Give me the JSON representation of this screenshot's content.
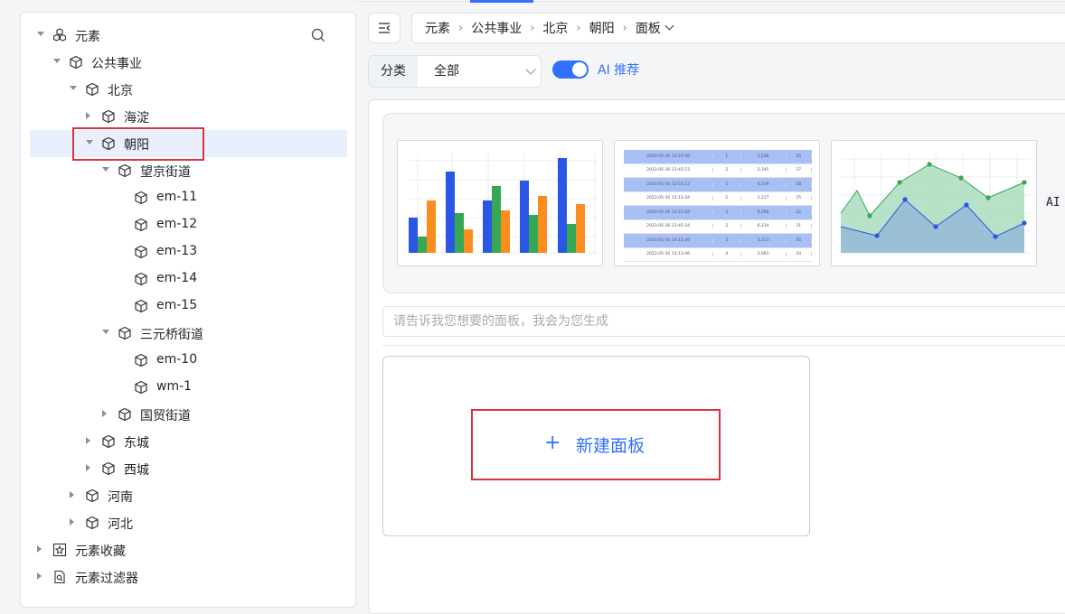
{
  "tree": {
    "items": [
      {
        "label": "元素",
        "icon": "elements-icon",
        "caret": "down"
      },
      {
        "label": "公共事业",
        "icon": "cube-icon",
        "caret": "down"
      },
      {
        "label": "北京",
        "icon": "cube-icon",
        "caret": "down"
      },
      {
        "label": "海淀",
        "icon": "cube-icon",
        "caret": "right"
      },
      {
        "label": "朝阳",
        "icon": "cube-icon",
        "caret": "down",
        "selected": true
      },
      {
        "label": "望京街道",
        "icon": "cube-icon",
        "caret": "down"
      },
      {
        "label": "em-11",
        "icon": "cube-icon",
        "caret": "none"
      },
      {
        "label": "em-12",
        "icon": "cube-icon",
        "caret": "none"
      },
      {
        "label": "em-13",
        "icon": "cube-icon",
        "caret": "none"
      },
      {
        "label": "em-14",
        "icon": "cube-icon",
        "caret": "none"
      },
      {
        "label": "em-15",
        "icon": "cube-icon",
        "caret": "none"
      },
      {
        "label": "三元桥街道",
        "icon": "cube-icon",
        "caret": "down"
      },
      {
        "label": "em-10",
        "icon": "cube-icon",
        "caret": "none"
      },
      {
        "label": "wm-1",
        "icon": "cube-icon",
        "caret": "none"
      },
      {
        "label": "国贸街道",
        "icon": "cube-icon",
        "caret": "right"
      },
      {
        "label": "东城",
        "icon": "cube-icon",
        "caret": "right"
      },
      {
        "label": "西城",
        "icon": "cube-icon",
        "caret": "right"
      },
      {
        "label": "河南",
        "icon": "cube-icon",
        "caret": "right"
      },
      {
        "label": "河北",
        "icon": "cube-icon",
        "caret": "right"
      },
      {
        "label": "元素收藏",
        "icon": "star-box-icon",
        "caret": "right"
      },
      {
        "label": "元素过滤器",
        "icon": "filter-doc-icon",
        "caret": "right"
      }
    ]
  },
  "breadcrumb": [
    "元素",
    "公共事业",
    "北京",
    "朝阳",
    "面板"
  ],
  "filter": {
    "tag": "分类",
    "selected": "全部"
  },
  "ai_toggle": {
    "label": "AI 推荐",
    "on": true
  },
  "templates_more_label": "AI",
  "prompt": {
    "placeholder": "请告诉我您想要的面板，我会为您生成",
    "value": ""
  },
  "new_panel": {
    "plus": "+",
    "label": "新建面板"
  },
  "colors": {
    "accent": "#3370ff",
    "highlight": "#d9333a",
    "green": "#34a853",
    "orange": "#fb8c1e"
  },
  "table_thumbnail": {
    "rows": [
      [
        "2023-05-16 13:23:48",
        "1",
        "3,546",
        "35"
      ],
      [
        "2023-05-16 13:45:23",
        "2",
        "2,345",
        "37"
      ],
      [
        "2023-05-16 12:53:12",
        "1",
        "6,239",
        "28"
      ],
      [
        "2023-05-16 13:12:34",
        "2",
        "1,217",
        "25"
      ],
      [
        "2023-05-16 13:23:28",
        "3",
        "6,290",
        "22"
      ],
      [
        "2023-05-16 13:45:34",
        "2",
        "6,214",
        "21"
      ],
      [
        "2023-05-16 14:12:39",
        "3",
        "3,213",
        "35"
      ],
      [
        "2023-05-16 14:13:46",
        "4",
        "3,061",
        "34"
      ]
    ]
  }
}
